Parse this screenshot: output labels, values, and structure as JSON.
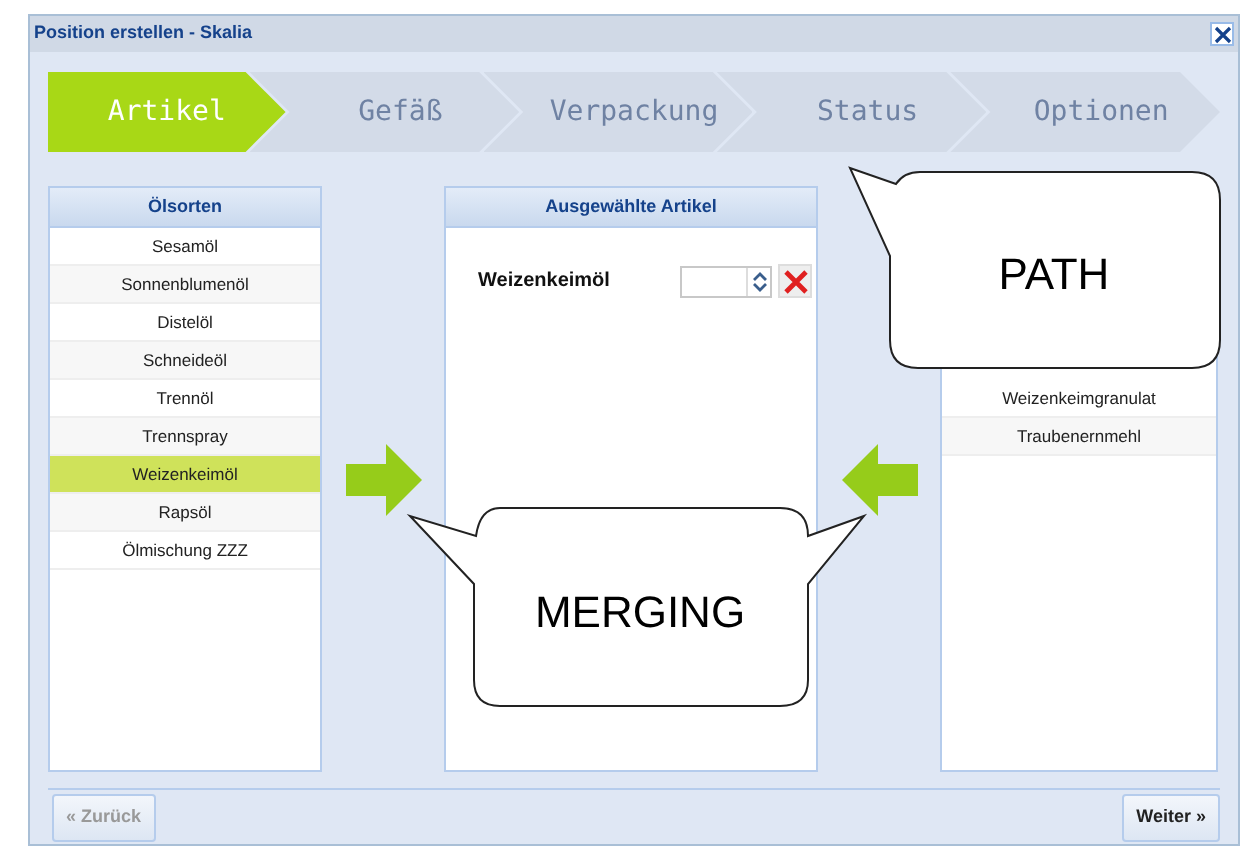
{
  "window": {
    "title": "Position erstellen - Skalia"
  },
  "steps": [
    {
      "label": "Artikel",
      "selected": true
    },
    {
      "label": "Gefäß",
      "selected": false
    },
    {
      "label": "Verpackung",
      "selected": false
    },
    {
      "label": "Status",
      "selected": false
    },
    {
      "label": "Optionen",
      "selected": false
    }
  ],
  "source_list": {
    "title": "Ölsorten",
    "items": [
      {
        "label": "Sesamöl",
        "selected": false
      },
      {
        "label": "Sonnenblumenöl",
        "selected": false
      },
      {
        "label": "Distelöl",
        "selected": false
      },
      {
        "label": "Schneideöl",
        "selected": false
      },
      {
        "label": "Trennöl",
        "selected": false
      },
      {
        "label": "Trennspray",
        "selected": false
      },
      {
        "label": "Weizenkeimöl",
        "selected": true
      },
      {
        "label": "Rapsöl",
        "selected": false
      },
      {
        "label": "Ölmischung ZZZ",
        "selected": false
      }
    ]
  },
  "selected_articles": {
    "title": "Ausgewählte Artikel",
    "rows": [
      {
        "label": "Weizenkeimöl"
      }
    ]
  },
  "target_list": {
    "items": [
      {
        "label": "Weizenkeimgranulat"
      },
      {
        "label": "Traubenernmehl"
      }
    ]
  },
  "buttons": [
    {
      "label": "« Zurück",
      "disabled": true
    },
    {
      "label": "Weiter »",
      "disabled": false
    }
  ],
  "callouts": [
    {
      "label": "PATH"
    },
    {
      "label": "MERGING"
    }
  ]
}
